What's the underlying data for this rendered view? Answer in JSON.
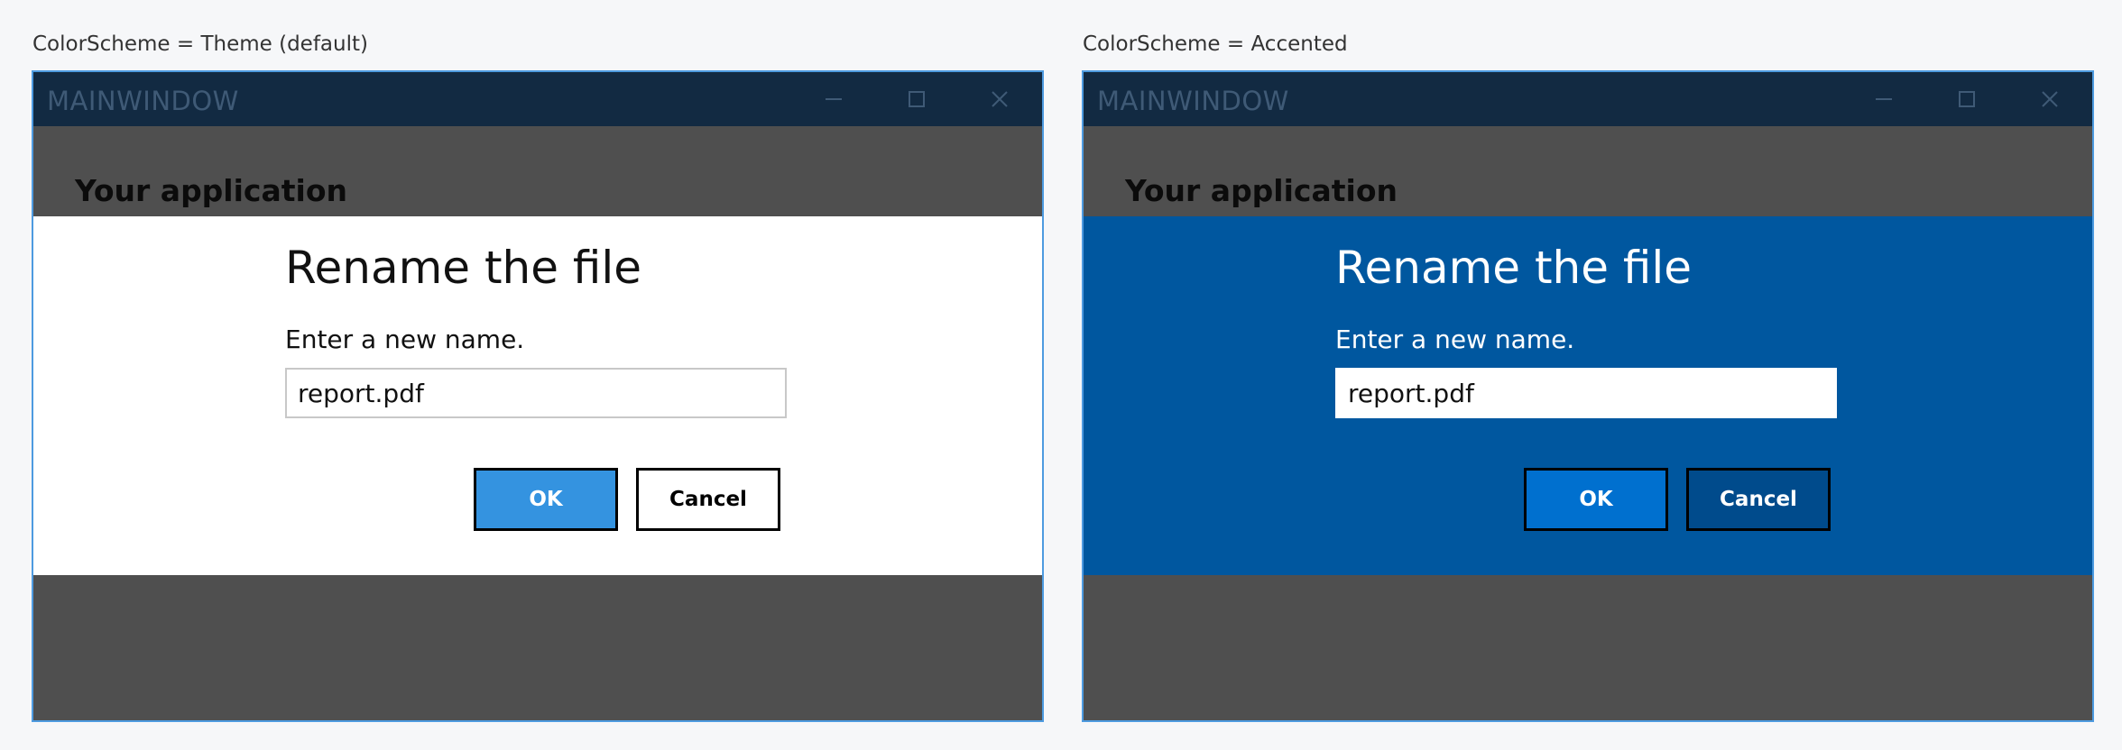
{
  "panels": [
    {
      "caption": "ColorScheme = Theme (default)",
      "window": {
        "title": "MAINWINDOW",
        "app_heading": "Your application",
        "dialog": {
          "title": "Rename the file",
          "message": "Enter a new name.",
          "input_value": "report.pdf",
          "ok_label": "OK",
          "cancel_label": "Cancel"
        }
      }
    },
    {
      "caption": "ColorScheme = Accented",
      "window": {
        "title": "MAINWINDOW",
        "app_heading": "Your application",
        "dialog": {
          "title": "Rename the file",
          "message": "Enter a new name.",
          "input_value": "report.pdf",
          "ok_label": "OK",
          "cancel_label": "Cancel"
        }
      }
    }
  ],
  "colors": {
    "page_background": "#f6f7f9",
    "titlebar": "#122a42",
    "window_body": "#4f4f4f",
    "window_border": "#4e9be0",
    "theme_overlay": "#ffffff",
    "accented_overlay": "#00579f",
    "theme_ok_button": "#3493e0",
    "accented_ok_button": "#0070cf",
    "accented_cancel_button": "#004b8c"
  },
  "icons": [
    "minimize-icon",
    "maximize-icon",
    "close-icon"
  ]
}
